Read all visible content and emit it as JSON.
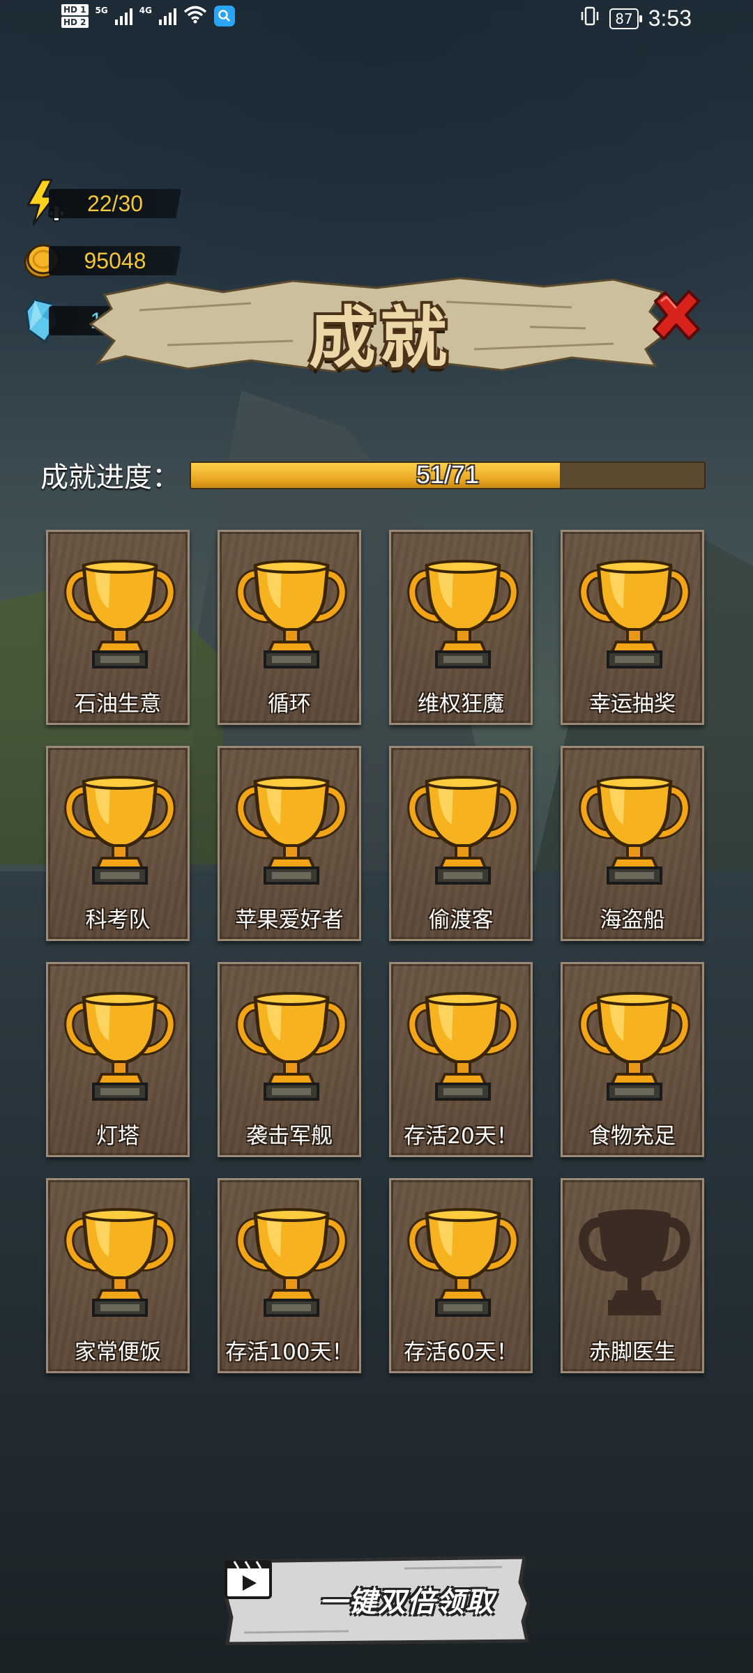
{
  "status_bar": {
    "sim1": "HD 1",
    "sim2": "HD 2",
    "net1": "5G",
    "net2": "4G",
    "battery": "87",
    "time": "3:53"
  },
  "resources": {
    "energy": "22/30",
    "coins": "95048",
    "gems": "1726"
  },
  "title": "成就",
  "progress": {
    "label": "成就进度：",
    "text": "51/71",
    "fraction": 0.7183
  },
  "achievements": [
    {
      "label": "石油生意",
      "unlocked": true
    },
    {
      "label": "循环",
      "unlocked": true
    },
    {
      "label": "维权狂魔",
      "unlocked": true
    },
    {
      "label": "幸运抽奖",
      "unlocked": true
    },
    {
      "label": "科考队",
      "unlocked": true
    },
    {
      "label": "苹果爱好者",
      "unlocked": true
    },
    {
      "label": "偷渡客",
      "unlocked": true
    },
    {
      "label": "海盗船",
      "unlocked": true
    },
    {
      "label": "灯塔",
      "unlocked": true
    },
    {
      "label": "袭击军舰",
      "unlocked": true
    },
    {
      "label": "存活20天！",
      "unlocked": true
    },
    {
      "label": "食物充足",
      "unlocked": true
    },
    {
      "label": "家常便饭",
      "unlocked": true
    },
    {
      "label": "存活100天！",
      "unlocked": true
    },
    {
      "label": "存活60天！",
      "unlocked": true
    },
    {
      "label": "赤脚医生",
      "unlocked": false
    }
  ],
  "claim_button": {
    "label": "一键双倍领取"
  },
  "colors": {
    "gold": "#f4c83a",
    "gem": "#6ad6ea",
    "close_red": "#d8231c"
  }
}
